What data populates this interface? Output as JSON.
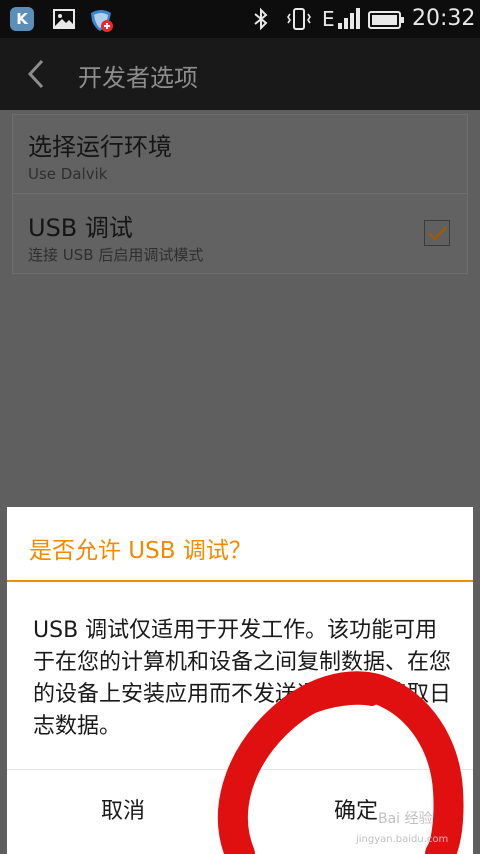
{
  "status_bar": {
    "app_icon_letter": "K",
    "network_label": "E",
    "time": "20:32",
    "icons": [
      "app-k-icon",
      "image-icon",
      "security-shield-icon",
      "bluetooth-icon",
      "vibrate-icon",
      "signal-icon",
      "battery-icon"
    ]
  },
  "title_bar": {
    "title": "开发者选项"
  },
  "settings": {
    "items": [
      {
        "title": "选择运行环境",
        "subtitle": "Use Dalvik"
      },
      {
        "title": "USB 调试",
        "subtitle": "连接 USB 后启用调试模式",
        "checked": true
      }
    ]
  },
  "dialog": {
    "title": "是否允许 USB 调试？",
    "message": "USB 调试仅适用于开发工作。该功能可用于在您的计算机和设备之间复制数据、在您的设备上安装应用而不发送通知以及读取日志数据。",
    "cancel_label": "取消",
    "ok_label": "确定"
  },
  "watermark": {
    "text": "Bai 经验",
    "url": "jingyan.baidu.com"
  },
  "colors": {
    "accent": "#f08a00",
    "status_bar_bg": "#0d0d0d",
    "title_bar_bg": "#191919",
    "dim_bg": "#5f5f5f",
    "annotation_red": "#e01010"
  }
}
